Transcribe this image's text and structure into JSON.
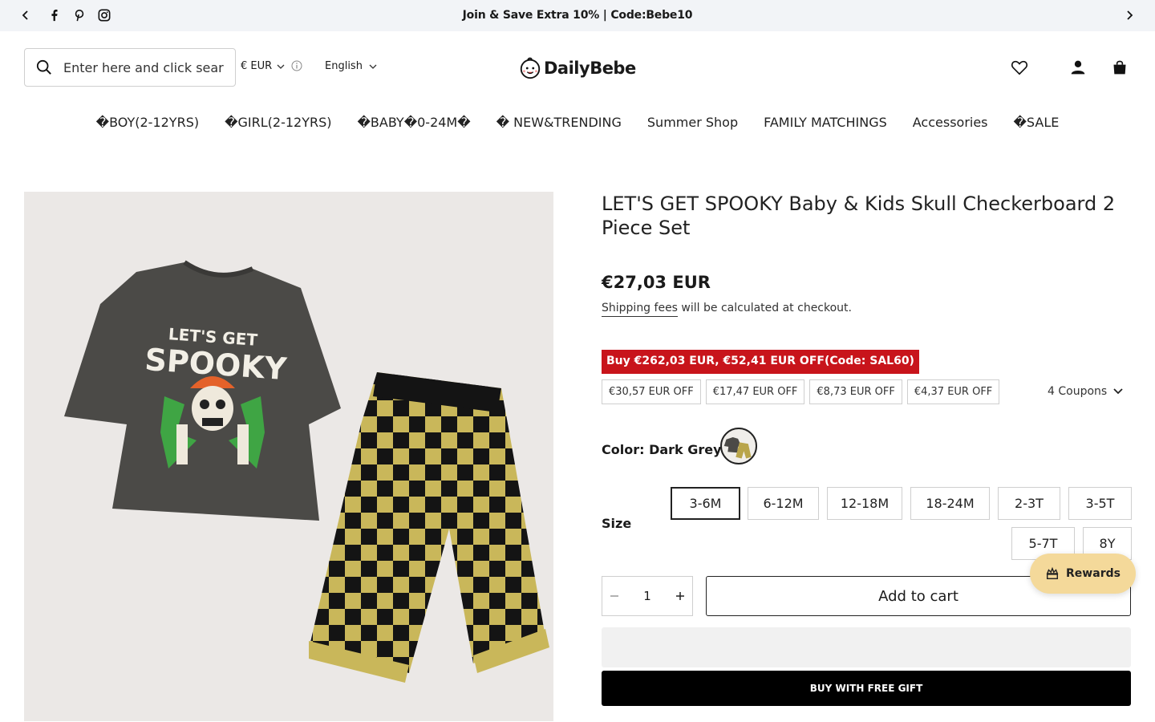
{
  "announcement": {
    "message": "Join & Save Extra 10% | Code:Bebe10"
  },
  "header": {
    "search_placeholder": "Enter here and click search",
    "currency": "€ EUR",
    "language": "English",
    "logo_text": "DailyBebe"
  },
  "nav": {
    "items": [
      "�BOY(2-12YRS)",
      "�GIRL(2-12YRS)",
      "�BABY�0-24M�",
      "� NEW&TRENDING",
      "Summer Shop",
      "FAMILY MATCHINGS",
      "Accessories",
      "�SALE"
    ]
  },
  "product": {
    "title": "LET'S GET SPOOKY Baby & Kids Skull Checkerboard 2 Piece Set",
    "price": "€27,03 EUR",
    "shipping_link": "Shipping fees",
    "shipping_rest": " will be calculated at checkout.",
    "promo": "Buy €262,03 EUR, €52,41 EUR OFF(Code: SAL60)",
    "coupons": [
      "€30,57 EUR OFF",
      "€17,47 EUR OFF",
      "€8,73 EUR OFF",
      "€4,37 EUR OFF"
    ],
    "coupon_toggle": "4 Coupons",
    "color_label": "Color: Dark Grey",
    "size_label": "Size",
    "sizes": [
      "3-6M",
      "6-12M",
      "12-18M",
      "18-24M",
      "2-3T",
      "3-5T",
      "5-7T",
      "8Y"
    ],
    "selected_size": "3-6M",
    "quantity": "1",
    "add_to_cart": "Add to cart",
    "buy_gift": "BUY WITH FREE GIFT",
    "image_text_top": "LET'S GET",
    "image_text_main": "SPOOKY"
  },
  "rewards": {
    "label": "Rewards"
  },
  "colors": {
    "promo_red": "#c8141b",
    "rewards_bg": "#f4d99a",
    "announce_bg": "#f2f4f7"
  }
}
